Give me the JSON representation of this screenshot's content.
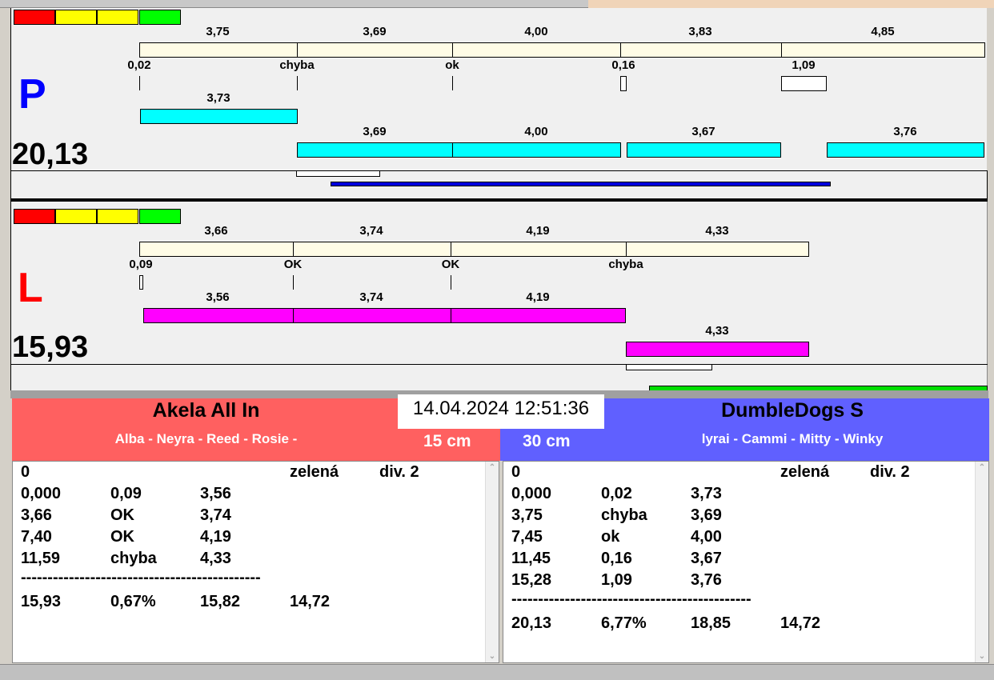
{
  "colors": {
    "red": "#ff0000",
    "yellow": "#ffff00",
    "green": "#00ff00",
    "team_left": "#ff6060",
    "team_right": "#6060ff"
  },
  "top": {
    "letter": "P",
    "total": "20,13",
    "ref_values": [
      "3,75",
      "3,69",
      "4,00",
      "3,83",
      "4,85"
    ],
    "marks": [
      "0,02",
      "chyba",
      "ok",
      "0,16",
      "1,09"
    ],
    "first_run": "3,73",
    "runs": [
      "3,69",
      "4,00",
      "3,67",
      "3,76"
    ]
  },
  "bottom": {
    "letter": "L",
    "total": "15,93",
    "ref_values": [
      "3,66",
      "3,74",
      "4,19",
      "4,33"
    ],
    "marks": [
      "0,09",
      "OK",
      "OK",
      "chyba"
    ],
    "runs": [
      "3,56",
      "3,74",
      "4,19"
    ],
    "last_run": "4,33"
  },
  "datetime": "14.04.2024 12:51:36",
  "left_team": {
    "name": "Akela All In",
    "dogs": "Alba - Neyra - Reed - Rosie -",
    "size": "15 cm",
    "header": [
      "0",
      "zelená",
      "div. 2"
    ],
    "rows": [
      [
        "0,000",
        "0,09",
        "3,56"
      ],
      [
        "3,66",
        "OK",
        "3,74"
      ],
      [
        "7,40",
        "OK",
        "4,19"
      ],
      [
        "11,59",
        "chyba",
        "4,33"
      ]
    ],
    "separator": "---------------------------------------------",
    "summary": [
      "15,93",
      "0,67%",
      "15,82",
      "14,72"
    ]
  },
  "right_team": {
    "name": "DumbleDogs S",
    "dogs": "lyrai - Cammi - Mitty - Winky",
    "size": "30 cm",
    "header": [
      "0",
      "zelená",
      "div. 2"
    ],
    "rows": [
      [
        "0,000",
        "0,02",
        "3,73"
      ],
      [
        "3,75",
        "chyba",
        "3,69"
      ],
      [
        "7,45",
        "ok",
        "4,00"
      ],
      [
        "11,45",
        "0,16",
        "3,67"
      ],
      [
        "15,28",
        "1,09",
        "3,76"
      ]
    ],
    "separator": "---------------------------------------------",
    "summary": [
      "20,13",
      "6,77%",
      "18,85",
      "14,72"
    ]
  }
}
